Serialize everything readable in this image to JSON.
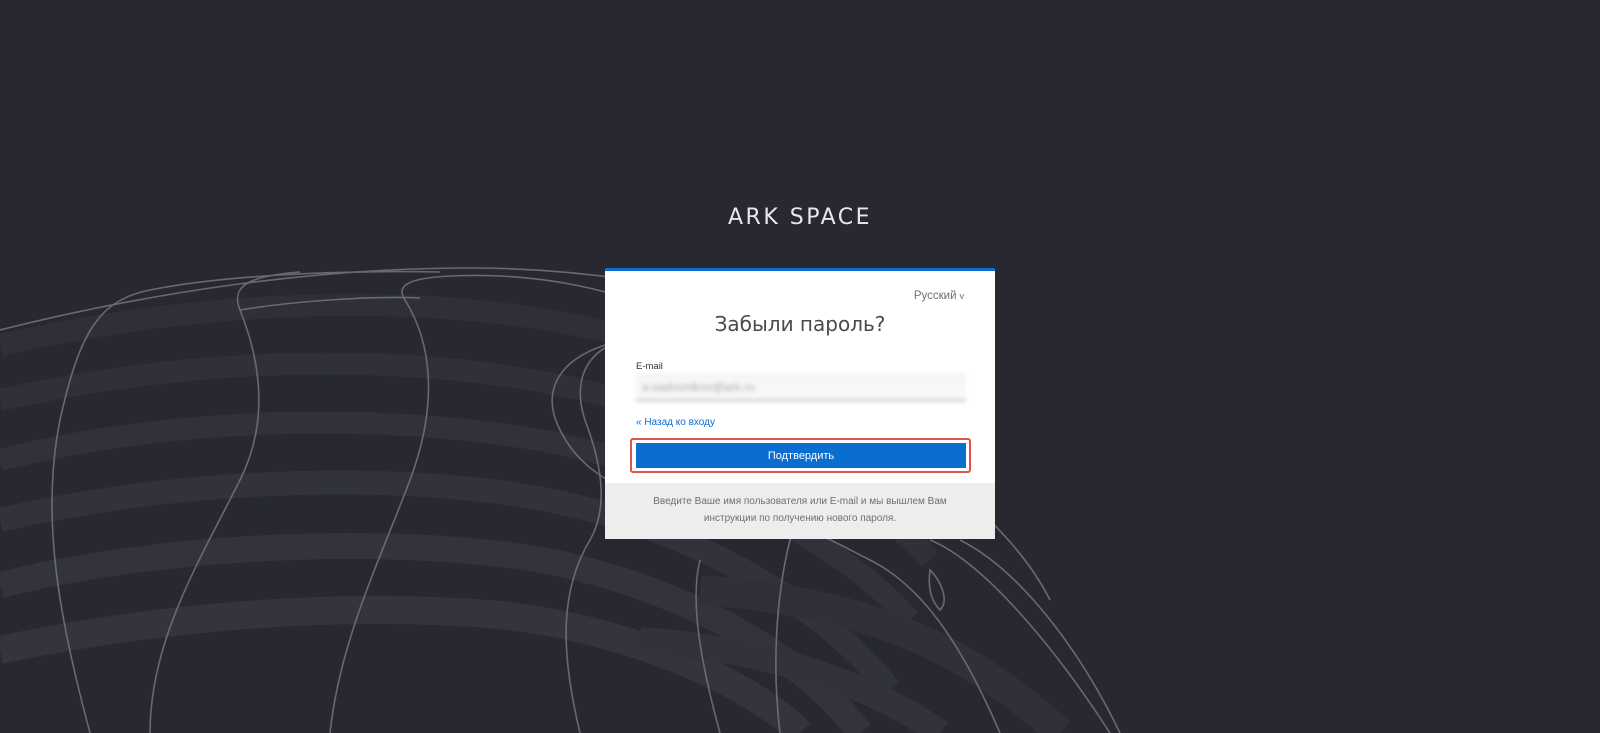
{
  "brand": {
    "title": "ARK SPACE"
  },
  "card": {
    "language": {
      "label": "Русский",
      "chevron": "v",
      "icon": "chevron-down-icon"
    },
    "title": "Забыли пароль?",
    "email": {
      "label": "E-mail",
      "value": "a.sadovnikov@ark.ru"
    },
    "back_link": "« Назад ко входу",
    "submit_label": "Подтвердить",
    "footer_text": "Введите Ваше имя пользователя или E-mail и мы вышлем Вам инструкции по получению нового пароля."
  },
  "colors": {
    "background": "#282930",
    "accent": "#0a6ed1",
    "highlight": "#e0524f",
    "footer_bg": "#ededed"
  }
}
